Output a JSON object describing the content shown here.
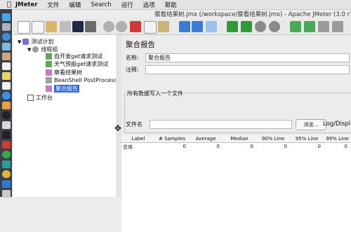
{
  "menubar": {
    "app": "JMeter",
    "items": [
      "文件",
      "编辑",
      "Search",
      "运行",
      "选项",
      "帮助"
    ]
  },
  "window_title": "察看结果树.jmx (/workspace/察看结果树.jmx) - Apache JMeter (3.0 r17",
  "tree": {
    "root": "测试计划",
    "thread_group": "线程组",
    "children": [
      "自开发get请求测试",
      "天气预报get请求测试",
      "察看结果树",
      "BeanShell PostProcessor",
      "聚合报告"
    ],
    "workbench": "工作台",
    "selected": "聚合报告"
  },
  "panel": {
    "title": "聚合报告",
    "name_label": "名称:",
    "name_value": "聚合报告",
    "comment_label": "注释:",
    "comment_value": "",
    "group_label": "所有数据写入一个文件",
    "filename_label": "文件名",
    "filename_value": "",
    "browse_label": "浏览...",
    "log_display": "Log/Displ"
  },
  "table": {
    "columns": [
      "Label",
      "# Samples",
      "Average",
      "Median",
      "90% Line",
      "95% Line",
      "99% Line"
    ],
    "rows": [
      [
        "总体",
        "0",
        "0",
        "0",
        "0",
        "0",
        "0"
      ]
    ]
  },
  "colors": {
    "selection": "#2f6bd3",
    "dock": "#3a3f48",
    "run_green": "#2e9a3a",
    "stop_gray": "#8a8a8a"
  }
}
